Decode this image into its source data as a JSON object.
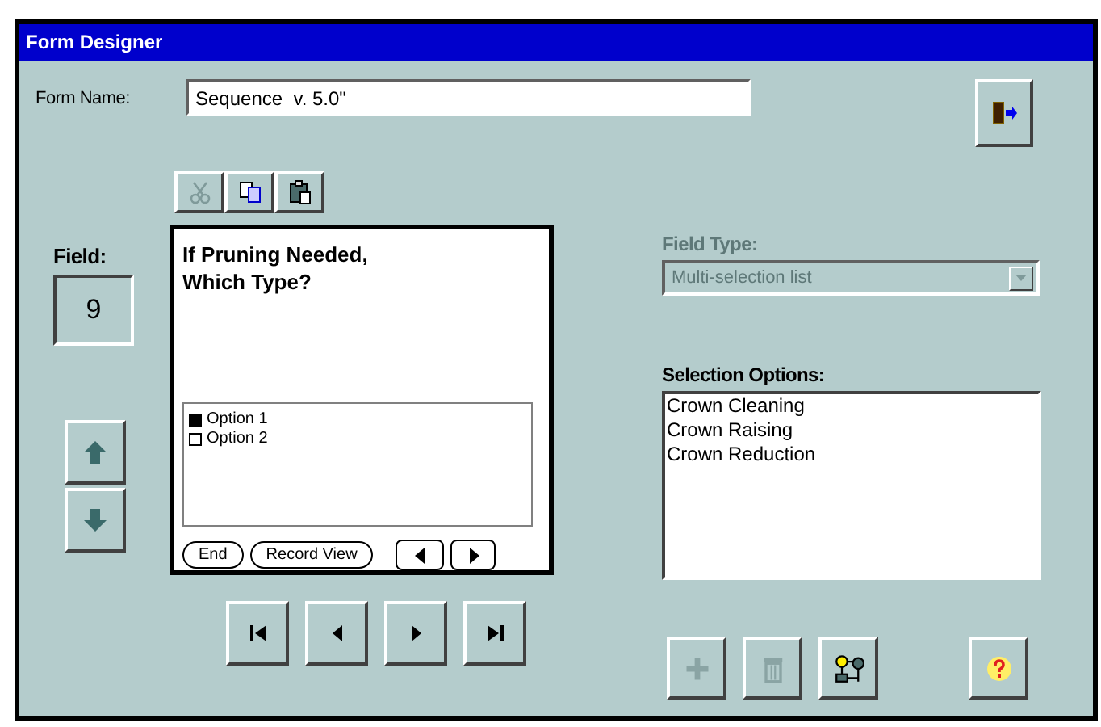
{
  "window": {
    "title": "Form Designer"
  },
  "form_name": {
    "label": "Form Name:",
    "value": "Sequence  v. 5.0\""
  },
  "toolbar": [
    {
      "kind": "cut",
      "disabled": true
    },
    {
      "kind": "copy",
      "disabled": false
    },
    {
      "kind": "paste",
      "disabled": false
    }
  ],
  "field": {
    "label": "Field:",
    "number": "9"
  },
  "preview": {
    "question": "If Pruning Needed,\nWhich Type?",
    "options": [
      {
        "label": "Option 1",
        "checked": true
      },
      {
        "label": "Option 2",
        "checked": false
      }
    ],
    "buttons": [
      "End",
      "Record View"
    ]
  },
  "field_type": {
    "label": "Field Type:",
    "value": "Multi-selection list",
    "disabled": true
  },
  "selection_options": {
    "label": "Selection Options:",
    "items": [
      "Crown Cleaning",
      "Crown Raising",
      "Crown Reduction"
    ]
  },
  "option_tools": [
    {
      "kind": "add",
      "disabled": true
    },
    {
      "kind": "delete",
      "disabled": true
    },
    {
      "kind": "branch",
      "disabled": false
    }
  ]
}
